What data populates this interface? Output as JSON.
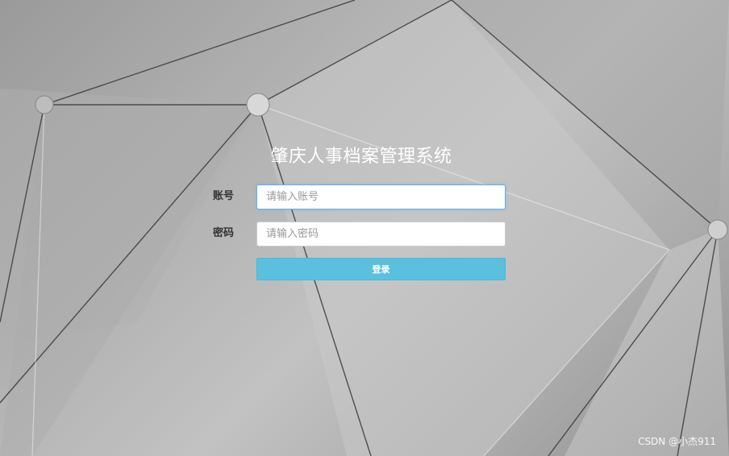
{
  "app": {
    "title": "肇庆人事档案管理系统"
  },
  "form": {
    "account_label": "账号",
    "account_placeholder": "请输入账号",
    "account_value": "",
    "password_label": "密码",
    "password_placeholder": "请输入密码",
    "password_value": "",
    "login_label": "登录"
  },
  "watermark": {
    "text": "CSDN @小杰911"
  },
  "colors": {
    "login_button": "#5bc0de",
    "title_text": "#ffffff",
    "focus_border": "#66afe9"
  },
  "background": {
    "icon": "polygon-network-background"
  }
}
